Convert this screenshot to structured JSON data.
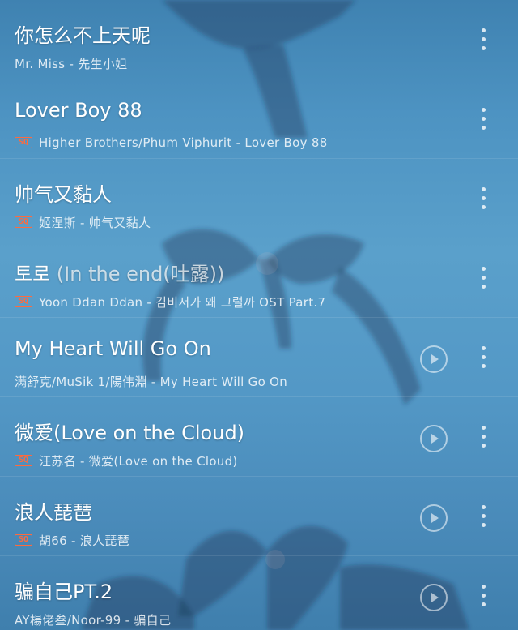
{
  "songs": [
    {
      "title": "你怎么不上天呢",
      "title_suffix": "",
      "badge": "",
      "subtitle": "Mr. Miss - 先生小姐",
      "has_play_button": false
    },
    {
      "title": "Lover Boy 88",
      "title_suffix": "",
      "badge": "SQ",
      "subtitle": "Higher Brothers/Phum Viphurit - Lover Boy 88",
      "has_play_button": false
    },
    {
      "title": "帅气又黏人",
      "title_suffix": "",
      "badge": "SQ",
      "subtitle": "姬涅斯 - 帅气又黏人",
      "has_play_button": false
    },
    {
      "title": "토로",
      "title_suffix": " (In the end(吐露))",
      "badge": "SQ",
      "subtitle": "Yoon Ddan Ddan - 김비서가 왜 그럴까 OST Part.7",
      "has_play_button": false
    },
    {
      "title": "My Heart Will Go On",
      "title_suffix": "",
      "badge": "",
      "subtitle": "满舒克/MuSik 1/陽伟淵 - My Heart Will Go On",
      "has_play_button": true
    },
    {
      "title": "微爱(Love on the Cloud)",
      "title_suffix": "",
      "badge": "SQ",
      "subtitle": "汪苏名 - 微爱(Love on the Cloud)",
      "has_play_button": true
    },
    {
      "title": "浪人琵琶",
      "title_suffix": "",
      "badge": "SQ",
      "subtitle": "胡66 - 浪人琵琶",
      "has_play_button": true
    },
    {
      "title": "骗自己PT.2",
      "title_suffix": "",
      "badge": "",
      "subtitle": "AY楊佬叁/Noor-99 - 骗自己",
      "has_play_button": true
    }
  ],
  "icons": {
    "play": "play-circle-icon",
    "more": "more-vertical-icon",
    "quality": "sq-badge"
  },
  "colors": {
    "background": "#4d93c2",
    "badge": "#ff6a3d",
    "text": "#ffffff"
  }
}
